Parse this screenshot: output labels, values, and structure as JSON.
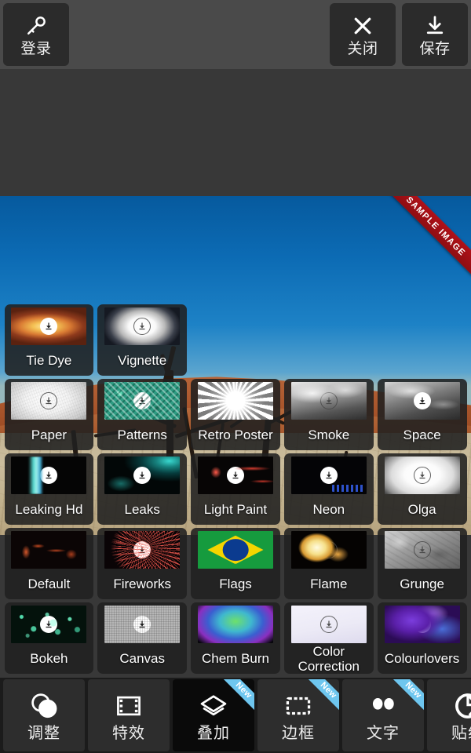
{
  "topbar": {
    "buttons": [
      {
        "label": "登录",
        "icon": "key-icon",
        "name": "login"
      },
      {
        "label": "关闭",
        "icon": "close-icon",
        "name": "close"
      },
      {
        "label": "保存",
        "icon": "save-download-icon",
        "name": "save"
      }
    ]
  },
  "photo": {
    "ribbon_text": "SAMPLE IMAGE",
    "description": "desert landscape with dead trees"
  },
  "grid": {
    "tiles": [
      {
        "label": "Tie Dye",
        "art": "a-tiedye",
        "dl": "solid"
      },
      {
        "label": "Vignette",
        "art": "a-vignette",
        "dl": "outline"
      },
      {
        "label": "",
        "art": "",
        "dl": "none"
      },
      {
        "label": "",
        "art": "",
        "dl": "none"
      },
      {
        "label": "",
        "art": "",
        "dl": "none"
      },
      {
        "label": "Paper",
        "art": "a-paper",
        "dl": "outline"
      },
      {
        "label": "Patterns",
        "art": "a-patterns",
        "dl": "solid"
      },
      {
        "label": "Retro Poster",
        "art": "a-retro",
        "dl": "outline"
      },
      {
        "label": "Smoke",
        "art": "a-smoke",
        "dl": "outline"
      },
      {
        "label": "Space",
        "art": "a-space",
        "dl": "solid"
      },
      {
        "label": "Leaking Hd",
        "art": "a-leakinghd",
        "dl": "solid"
      },
      {
        "label": "Leaks",
        "art": "a-leaks",
        "dl": "solid"
      },
      {
        "label": "Light Paint",
        "art": "a-lightpaint",
        "dl": "solid"
      },
      {
        "label": "Neon",
        "art": "a-neon",
        "dl": "solid"
      },
      {
        "label": "Olga",
        "art": "a-olga",
        "dl": "outline"
      },
      {
        "label": "Default",
        "art": "a-default",
        "dl": "none"
      },
      {
        "label": "Fireworks",
        "art": "a-fireworks",
        "dl": "solid"
      },
      {
        "label": "Flags",
        "art": "a-flags",
        "dl": "solid"
      },
      {
        "label": "Flame",
        "art": "a-flame",
        "dl": "outline"
      },
      {
        "label": "Grunge",
        "art": "a-grunge",
        "dl": "outline"
      },
      {
        "label": "Bokeh",
        "art": "a-bokeh",
        "dl": "solid"
      },
      {
        "label": "Canvas",
        "art": "a-canvas",
        "dl": "solid"
      },
      {
        "label": "Chem Burn",
        "art": "a-chemburn",
        "dl": "solid"
      },
      {
        "label": "Color Correction",
        "art": "a-colorcorr",
        "dl": "outline"
      },
      {
        "label": "Colourlovers",
        "art": "a-colourlovers",
        "dl": "solid"
      }
    ]
  },
  "bottomnav": {
    "new_badge_text": "New",
    "items": [
      {
        "label": "调整",
        "icon": "adjust-circles-icon",
        "name": "adjust",
        "active": false,
        "badge": false
      },
      {
        "label": "特效",
        "icon": "filmstrip-icon",
        "name": "effects",
        "active": false,
        "badge": false
      },
      {
        "label": "叠加",
        "icon": "layers-icon",
        "name": "overlay",
        "active": true,
        "badge": true
      },
      {
        "label": "边框",
        "icon": "frame-icon",
        "name": "frame",
        "active": false,
        "badge": true
      },
      {
        "label": "文字",
        "icon": "quote-icon",
        "name": "text",
        "active": false,
        "badge": true
      },
      {
        "label": "贴纸",
        "icon": "sticker-icon",
        "name": "sticker",
        "active": false,
        "badge": false
      }
    ]
  },
  "colors": {
    "topbar_bg": "#4a4a4a",
    "button_bg": "#2b2b2b",
    "canvas_bg": "#383838",
    "nav_bg": "#1b1b1b",
    "nav_item_bg": "#2d2d2d",
    "nav_active_bg": "#0a0a0a",
    "badge_blue": "#6ec6ef",
    "ribbon_red": "#b01118"
  }
}
